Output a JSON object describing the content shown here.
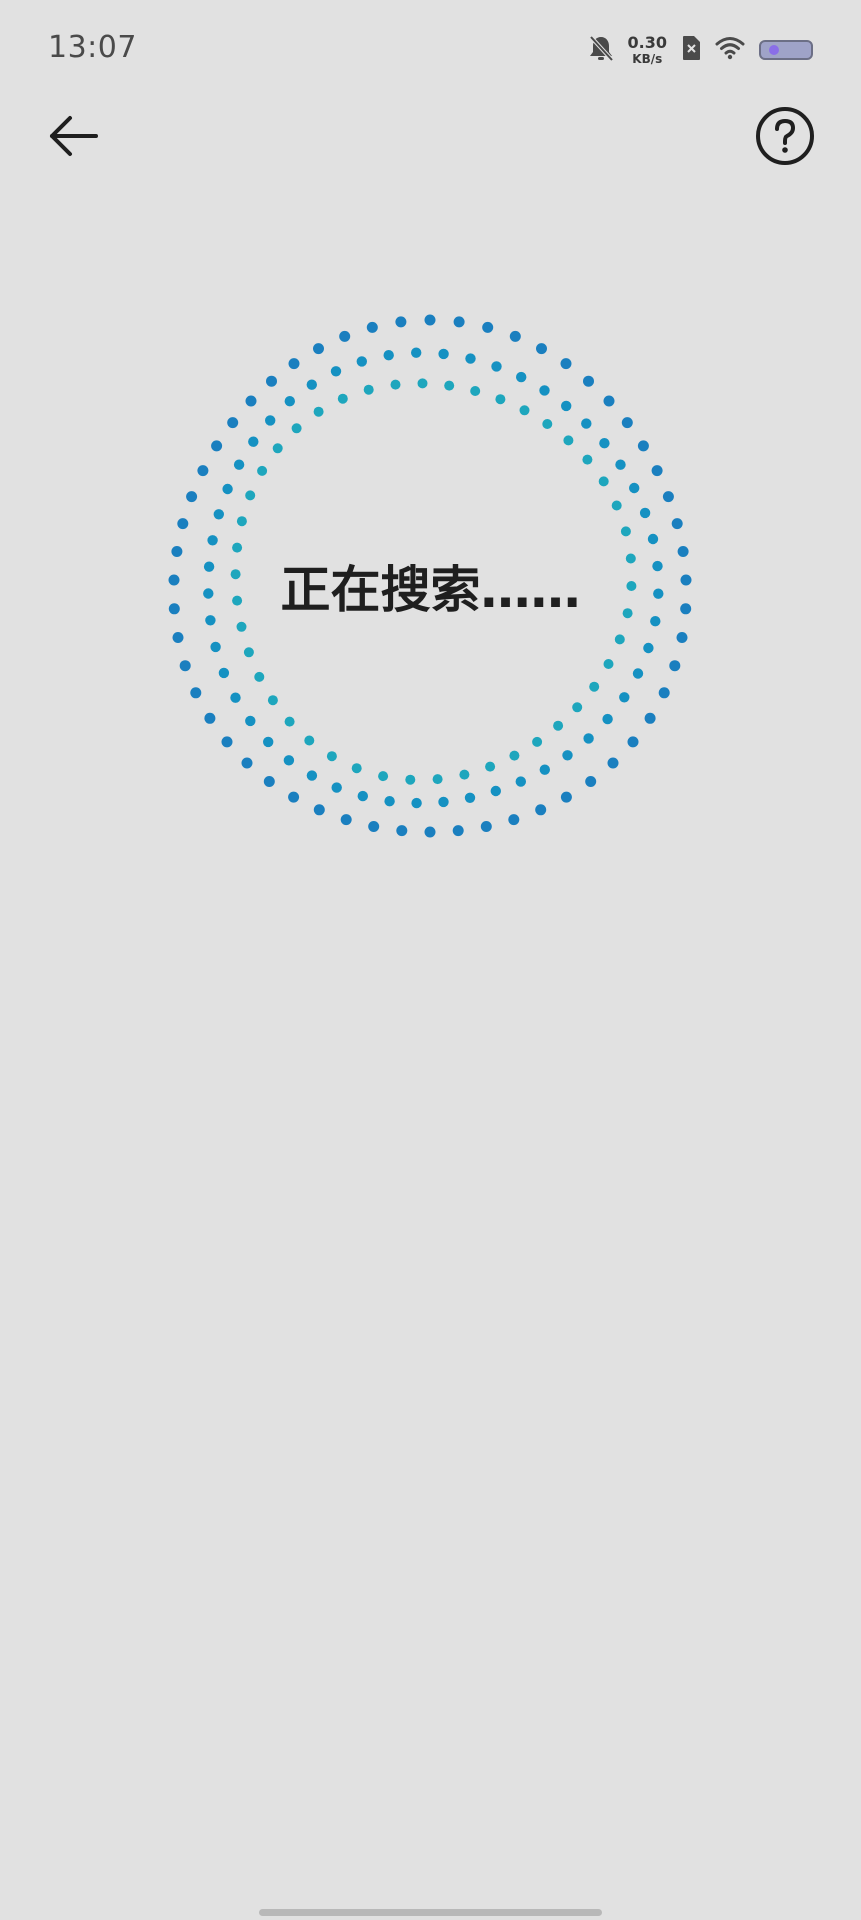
{
  "status_bar": {
    "time": "13:07",
    "net_speed_value": "0.30",
    "net_speed_unit": "KB/s",
    "icons": [
      "bell-off-icon",
      "sim-x-icon",
      "wifi-icon",
      "battery-icon"
    ]
  },
  "header": {
    "back_icon": "arrow-left-icon",
    "help_icon": "question-circle-icon"
  },
  "main": {
    "status_text": "正在搜索……"
  },
  "colors": {
    "background": "#e1e1e1",
    "ring_outer": "#1a7fbf",
    "ring_middle": "#1591c2",
    "ring_inner": "#1ea6bd",
    "text": "#1f1f1f"
  }
}
